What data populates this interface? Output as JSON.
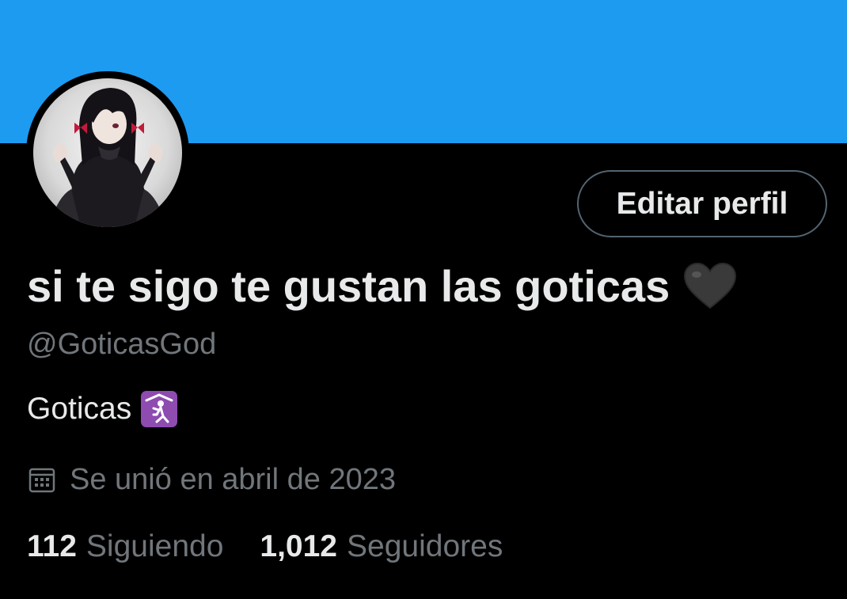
{
  "profile": {
    "display_name": "si te sigo te gustan las goticas",
    "display_name_emoji": "black-heart-icon",
    "handle": "@GoticasGod",
    "bio_text": "Goticas",
    "bio_emoji": "place-of-worship-icon",
    "joined_icon": "calendar-icon",
    "joined_text": "Se unió en abril de 2023",
    "avatar_icon": "avatar-image"
  },
  "actions": {
    "edit_profile_label": "Editar perfil"
  },
  "stats": {
    "following_count": "112",
    "following_label": "Siguiendo",
    "followers_count": "1,012",
    "followers_label": "Seguidores"
  },
  "colors": {
    "banner": "#1d9bf0",
    "background": "#000000",
    "primary_text": "#e7e9ea",
    "secondary_text": "#71767b",
    "button_border": "#536471"
  }
}
